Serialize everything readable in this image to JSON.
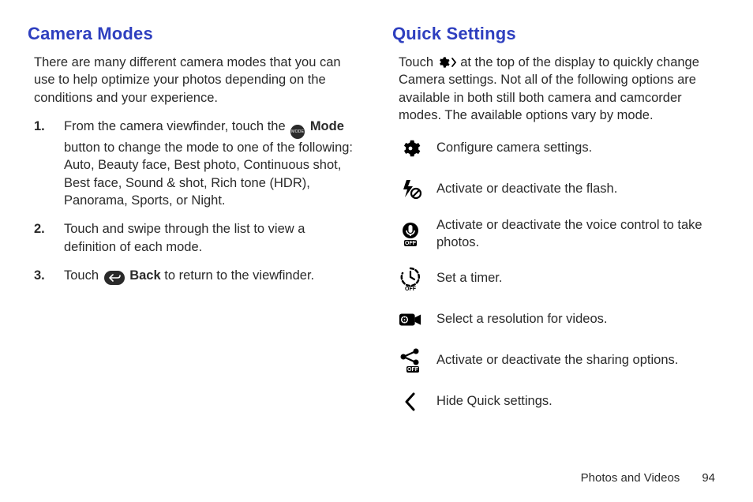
{
  "left": {
    "heading": "Camera Modes",
    "intro": "There are many different camera modes that you can use to help optimize your photos depending on the conditions and your experience.",
    "items": [
      {
        "num": "1.",
        "pre": "From the camera viewfinder, touch the ",
        "icon": "mode-icon",
        "bold": "Mode",
        "post": " button to change the mode to one of the following: Auto, Beauty face, Best photo, Continuous shot, Best face, Sound & shot, Rich tone (HDR), Panorama, Sports, or Night."
      },
      {
        "num": "2.",
        "pre": "Touch and swipe through the list to view a definition of each mode.",
        "icon": "",
        "bold": "",
        "post": ""
      },
      {
        "num": "3.",
        "pre": "Touch ",
        "icon": "back-icon",
        "bold": "Back",
        "post": " to return to the viewfinder."
      }
    ]
  },
  "right": {
    "heading": "Quick Settings",
    "intro_pre": "Touch ",
    "intro_post": " at the top of the display to quickly change Camera settings. Not all of the following options are available in both still both camera and camcorder modes. The available options vary by mode.",
    "rows": [
      {
        "icon": "gear-icon",
        "text": "Configure camera settings."
      },
      {
        "icon": "flash-icon",
        "text": "Activate or deactivate the flash."
      },
      {
        "icon": "voice-icon",
        "text": "Activate or deactivate the voice control to take photos."
      },
      {
        "icon": "timer-icon",
        "text": "Set a timer."
      },
      {
        "icon": "video-icon",
        "text": "Select a resolution for videos."
      },
      {
        "icon": "share-icon",
        "text": "Activate or deactivate the sharing options."
      },
      {
        "icon": "chevron-icon",
        "text": "Hide Quick settings."
      }
    ]
  },
  "footer": {
    "section": "Photos and Videos",
    "page": "94"
  }
}
